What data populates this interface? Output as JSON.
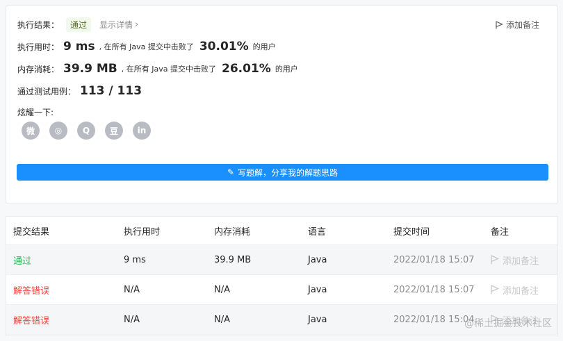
{
  "result": {
    "status_label": "执行结果：",
    "status_value": "通过",
    "details_link": "显示详情",
    "add_note": "添加备注",
    "runtime_label": "执行用时：",
    "runtime_value": "9 ms",
    "runtime_text": ", 在所有 Java 提交中击败了",
    "runtime_pct": "30.01%",
    "runtime_users": "的用户",
    "memory_label": "内存消耗：",
    "memory_value": "39.9 MB",
    "memory_text": ", 在所有 Java 提交中击败了",
    "memory_pct": "26.01%",
    "memory_users": "的用户",
    "tests_label": "通过测试用例：",
    "tests_value": "113 / 113",
    "share_label": "炫耀一下:",
    "share_icons": [
      {
        "name": "wechat-icon",
        "glyph": "微"
      },
      {
        "name": "weibo-icon",
        "glyph": "◎"
      },
      {
        "name": "qq-icon",
        "glyph": "Q"
      },
      {
        "name": "douban-icon",
        "glyph": "豆"
      },
      {
        "name": "linkedin-icon",
        "glyph": "in"
      }
    ],
    "write_button": "写题解，分享我的解题思路"
  },
  "table": {
    "headers": [
      "提交结果",
      "执行用时",
      "内存消耗",
      "语言",
      "提交时间",
      "备注"
    ],
    "rows": [
      {
        "status": "通过",
        "runtime": "9 ms",
        "memory": "39.9 MB",
        "lang": "Java",
        "time": "2022/01/18 15:07",
        "note": "添加备注"
      },
      {
        "status": "解答错误",
        "runtime": "N/A",
        "memory": "N/A",
        "lang": "Java",
        "time": "2022/01/18 15:07",
        "note": "添加备注"
      },
      {
        "status": "解答错误",
        "runtime": "N/A",
        "memory": "N/A",
        "lang": "Java",
        "time": "2022/01/18 15:04",
        "note": "添加备注"
      }
    ]
  },
  "watermark": "@稀土掘金技术社区",
  "colors": {
    "accent": "#1a90ff",
    "pass": "#2db55d",
    "fail": "#ef4743"
  }
}
